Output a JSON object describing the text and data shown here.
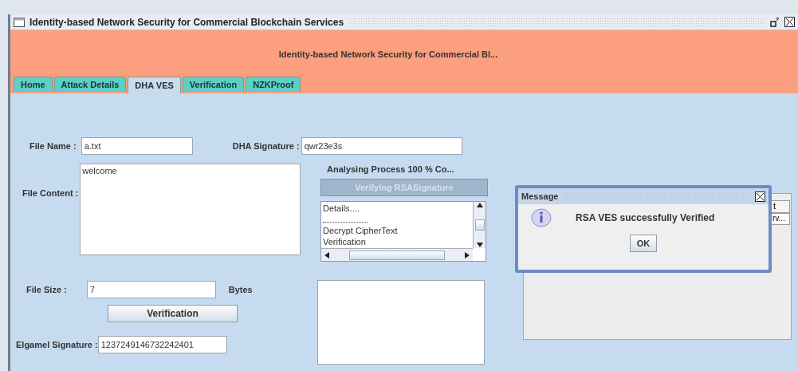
{
  "window": {
    "title": "Identity-based Network Security for Commercial Blockchain Services"
  },
  "header": {
    "title": "Identity-based Network Security for Commercial Bl..."
  },
  "tabs": [
    {
      "label": "Home",
      "selected": false
    },
    {
      "label": "Attack Details",
      "selected": false
    },
    {
      "label": "DHA VES",
      "selected": true
    },
    {
      "label": "Verification",
      "selected": false
    },
    {
      "label": "NZKProof",
      "selected": false
    }
  ],
  "form": {
    "file_name": {
      "label": "File Name :",
      "value": "a.txt"
    },
    "dha_signature": {
      "label": "DHA Signature :",
      "value": "qwr23e3s"
    },
    "file_content": {
      "label": "File Content :",
      "value": "welcome"
    },
    "file_size": {
      "label": "File Size :",
      "value": "7",
      "unit": "Bytes"
    },
    "verification_button": "Verification",
    "elgamel_signature": {
      "label": "Elgamel Signature :",
      "value": "1237249146732242401"
    }
  },
  "process": {
    "status": "Analysing Process 100 % Co...",
    "button": {
      "label": "Verifying RSASignature",
      "disabled": true
    },
    "log": [
      {
        "kind": "text",
        "text": "Details...."
      },
      {
        "kind": "separator"
      },
      {
        "kind": "text",
        "text": "Decrypt CipherText"
      },
      {
        "kind": "text",
        "text": "Verification"
      }
    ]
  },
  "table": {
    "columns": [
      "t"
    ],
    "rows": [
      [
        "rv..."
      ]
    ]
  },
  "dialog": {
    "title": "Message",
    "message": "RSA VES successfully Verified",
    "button": "OK"
  }
}
